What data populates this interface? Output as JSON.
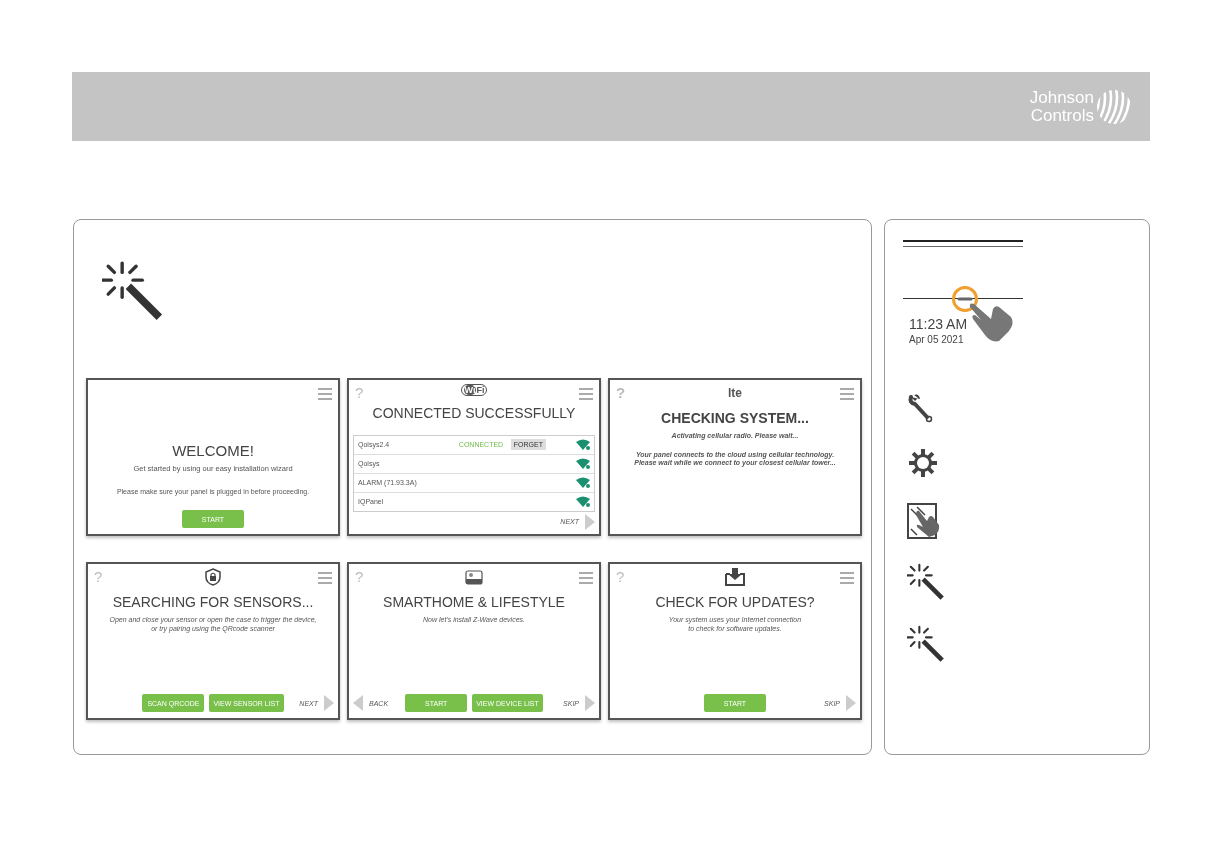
{
  "header": {
    "logo": {
      "line_1": "Johnson",
      "line_2": "Controls"
    }
  },
  "screens": [
    {
      "kind": "welcome",
      "title": "WELCOME!",
      "subtitle": [
        "Get started by using our easy installation wizard"
      ],
      "note": [
        "Please make sure your panel is plugged in before proceeding."
      ],
      "buttons": [
        "START"
      ]
    },
    {
      "kind": "wifi",
      "help": "?",
      "badge": [
        "Wi",
        "Fi"
      ],
      "title": "CONNECTED SUCCESSFULLY",
      "networks": [
        {
          "name": "Qolsys2.4",
          "status": "CONNECTED",
          "action": "FORGET"
        },
        {
          "name": "Qolsys"
        },
        {
          "name": "ALARM (71.93.3A)"
        },
        {
          "name": "IQPanel"
        }
      ],
      "next": "NEXT"
    },
    {
      "kind": "lte",
      "help": "?",
      "badge": [
        "lte"
      ],
      "title": "CHECKING SYSTEM...",
      "subtitle": [
        "Activating cellular radio. Please wait..."
      ],
      "note": [
        "Your panel connects to the cloud using cellular technology.",
        "Please wait while we connect to your closest cellular tower..."
      ]
    },
    {
      "kind": "sensors",
      "help": "?",
      "title": "SEARCHING FOR SENSORS...",
      "subtitle": [
        "Open and close your sensor or open the case to trigger the device,",
        "or try pairing using the QRcode scanner"
      ],
      "buttons": [
        "SCAN QRCODE",
        "VIEW SENSOR LIST"
      ],
      "next": "NEXT"
    },
    {
      "kind": "zwave",
      "help": "?",
      "title": "SMARTHOME & LIFESTYLE",
      "subtitle": [
        "Now let's install Z-Wave devices."
      ],
      "buttons": [
        "START",
        "VIEW DEVICE LIST"
      ],
      "back": "BACK",
      "next": "SKIP"
    },
    {
      "kind": "updates",
      "help": "?",
      "title": "CHECK FOR UPDATES?",
      "subtitle": [
        "Your system uses your Internet connection",
        "to check for software updates."
      ],
      "buttons": [
        "START"
      ],
      "next": "SKIP"
    }
  ],
  "sidebar": {
    "time": "11:23 AM",
    "date": "Apr 05 2021"
  }
}
